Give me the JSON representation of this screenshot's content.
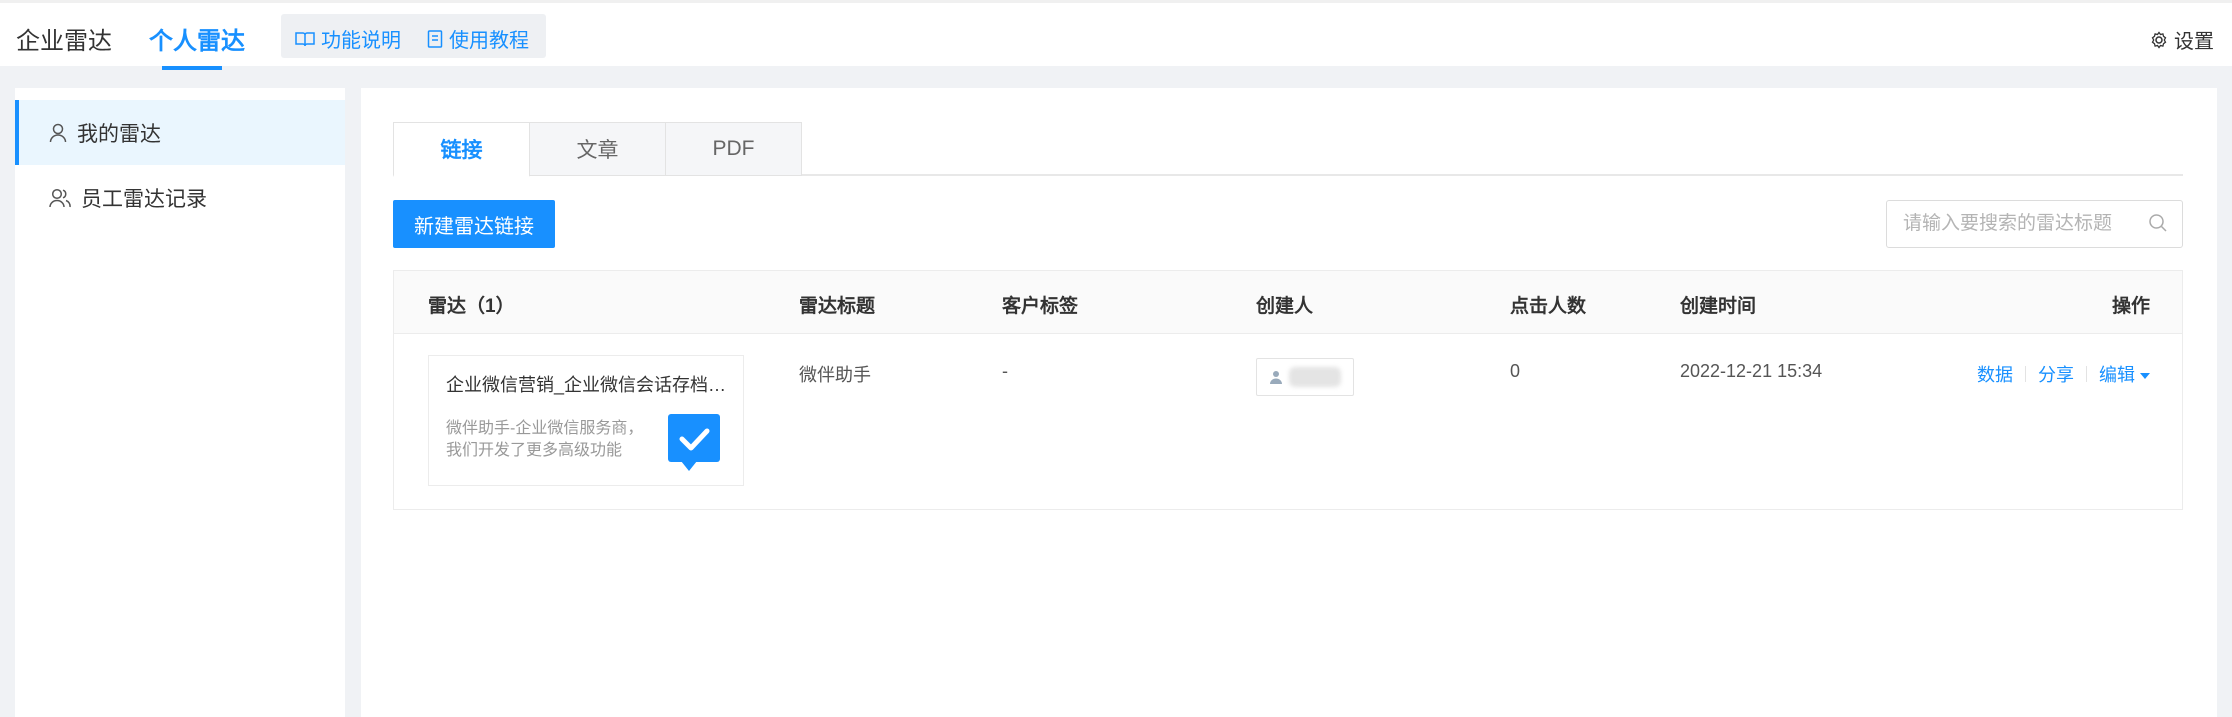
{
  "topnav": {
    "tabs": [
      {
        "label": "企业雷达",
        "active": false
      },
      {
        "label": "个人雷达",
        "active": true
      }
    ],
    "help_links": [
      {
        "label": "功能说明",
        "icon": "book-icon"
      },
      {
        "label": "使用教程",
        "icon": "document-icon"
      }
    ],
    "settings_label": "设置"
  },
  "sidebar": {
    "items": [
      {
        "label": "我的雷达",
        "icon": "user-icon",
        "active": true
      },
      {
        "label": "员工雷达记录",
        "icon": "users-icon",
        "active": false
      }
    ]
  },
  "main": {
    "tabs": [
      {
        "label": "链接",
        "active": true
      },
      {
        "label": "文章",
        "active": false
      },
      {
        "label": "PDF",
        "active": false
      }
    ],
    "new_button_label": "新建雷达链接",
    "search": {
      "placeholder": "请输入要搜索的雷达标题",
      "value": ""
    },
    "table": {
      "columns": [
        "雷达（1）",
        "雷达标题",
        "客户标签",
        "创建人",
        "点击人数",
        "创建时间",
        "操作"
      ],
      "rows": [
        {
          "card_title": "企业微信营销_企业微信会话存档_企业微信SCRM",
          "card_desc": "微伴助手-企业微信服务商，我们开发了更多高级功能",
          "radar_title": "微伴助手",
          "customer_tag": "-",
          "clicks": "0",
          "created_at": "2022-12-21 15:34",
          "actions": [
            "数据",
            "分享",
            "编辑"
          ]
        }
      ]
    }
  },
  "colors": {
    "accent": "#1890ff",
    "background": "#f0f2f5",
    "sidebar_active": "#eaf6fe"
  }
}
